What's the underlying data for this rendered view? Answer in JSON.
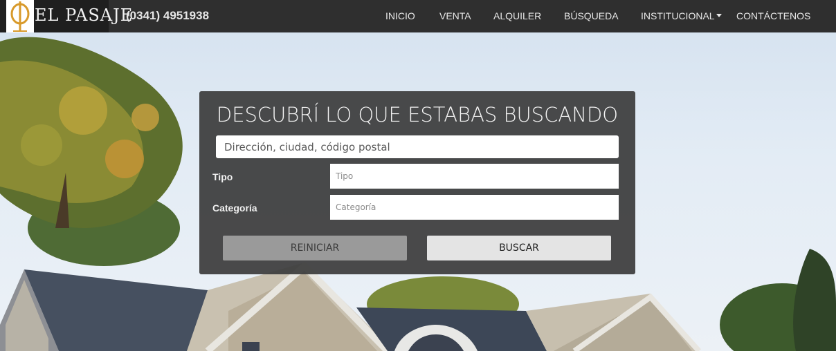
{
  "brand": {
    "name": "EL PASAJE",
    "phone": "(0341) 4951938"
  },
  "nav": {
    "items": [
      {
        "label": "INICIO"
      },
      {
        "label": "VENTA"
      },
      {
        "label": "ALQUILER"
      },
      {
        "label": "BÚSQUEDA"
      },
      {
        "label": "INSTITUCIONAL",
        "has_dropdown": true
      },
      {
        "label": "CONTÁCTENOS"
      }
    ],
    "dropdown_icon": "caret-down-icon"
  },
  "search": {
    "title": "DESCUBRÍ LO QUE ESTABAS BUSCANDO",
    "address_placeholder": "Dirección, ciudad, código postal",
    "tipo_label": "Tipo",
    "tipo_placeholder": "Tipo",
    "categoria_label": "Categoría",
    "categoria_placeholder": "Categoría",
    "reset_label": "REINICIAR",
    "submit_label": "BUSCAR"
  },
  "colors": {
    "navbar": "#2f2f2f",
    "panel": "#3c3c3c",
    "logo_gold": "#d89a2b"
  }
}
